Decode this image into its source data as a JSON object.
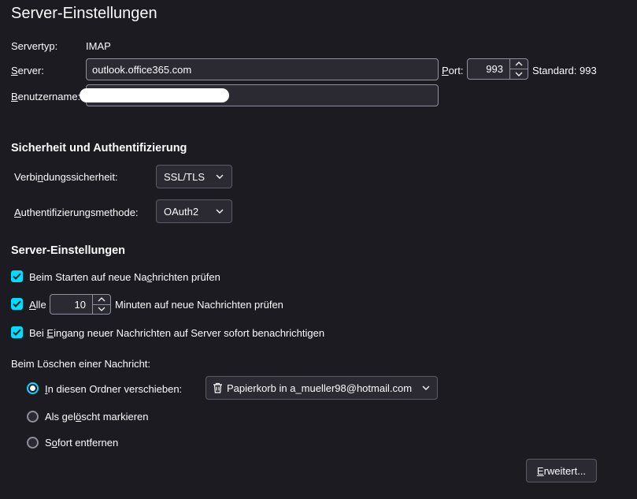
{
  "page": {
    "title": "Server-Einstellungen"
  },
  "server": {
    "type_label": "Servertyp:",
    "type_value": "IMAP",
    "server_label_ul": "S",
    "server_label_rest": "erver:",
    "server_value": "outlook.office365.com",
    "port_label_ul": "P",
    "port_label_rest": "ort:",
    "port_value": "993",
    "standard_label": "Standard: 993",
    "username_label_ul": "B",
    "username_label_rest": "enutzername:"
  },
  "security": {
    "heading": "Sicherheit und Authentifizierung",
    "connection_label_a": "Verbi",
    "connection_label_ul": "n",
    "connection_label_b": "dungssicherheit:",
    "connection_value": "SSL/TLS",
    "auth_label_ul": "A",
    "auth_label_rest": "uthentifizierungsmethode:",
    "auth_value": "OAuth2"
  },
  "settings": {
    "heading": "Server-Einstellungen",
    "check_new_a": "Beim Starten auf neue Na",
    "check_new_ul": "c",
    "check_new_b": "hrichten prüfen",
    "every_ul": "A",
    "every_rest": "lle",
    "minutes_value": "10",
    "minutes_label": "Minuten auf neue Nachrichten prüfen",
    "notify_a": "Bei ",
    "notify_ul": "E",
    "notify_b": "ingang neuer Nachrichten auf Server sofort benachrichtigen"
  },
  "delete": {
    "label": "Beim Löschen einer Nachricht:",
    "move_ul": "I",
    "move_rest": "n diesen Ordner verschieben:",
    "folder_value": "Papierkorb in a_mueller98@hotmail.com",
    "mark_a": "Als gel",
    "mark_ul": "ö",
    "mark_b": "scht markieren",
    "remove_a": "S",
    "remove_ul": "o",
    "remove_b": "fort entfernen"
  },
  "advanced": {
    "ul": "E",
    "rest": "rweitert..."
  },
  "colors": {
    "accent": "#00ddff",
    "background": "#1c1b22",
    "field": "#2b2a33"
  }
}
